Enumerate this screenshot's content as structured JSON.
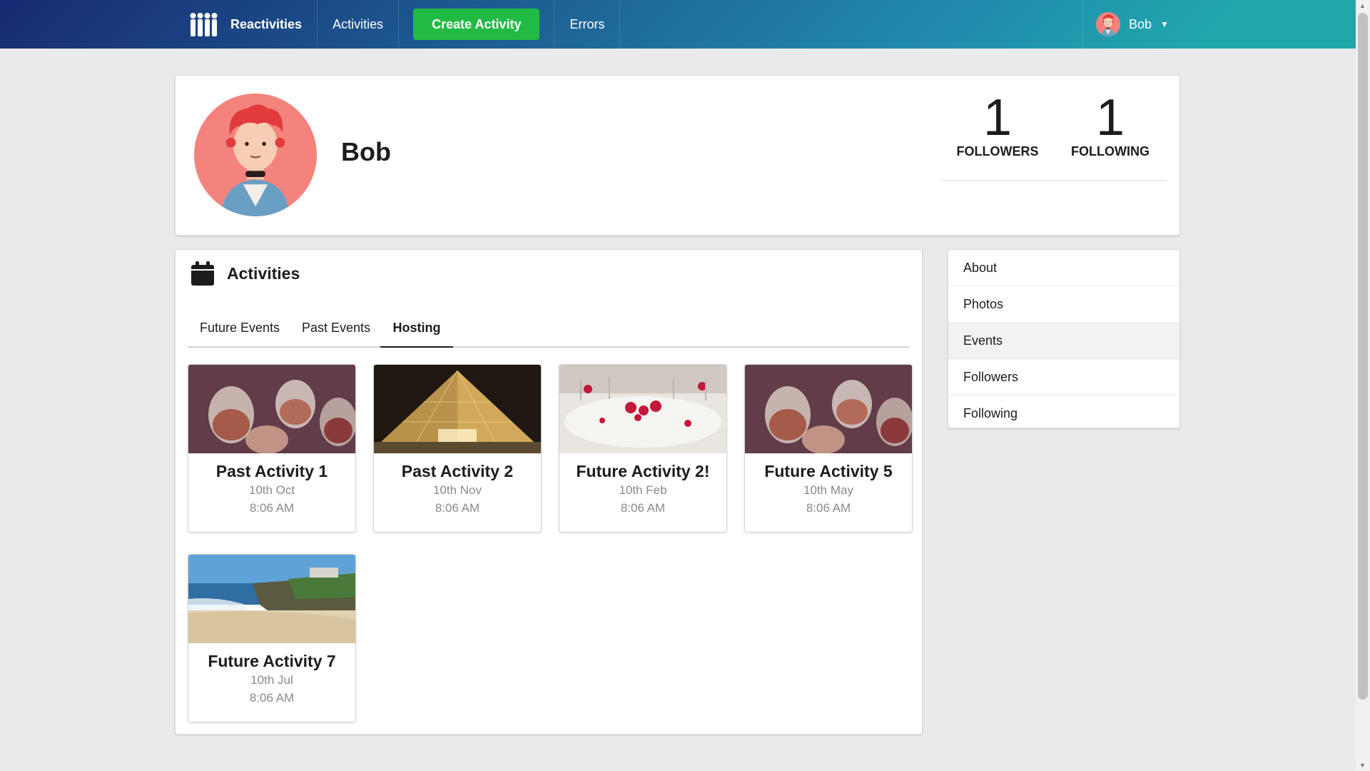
{
  "nav": {
    "brand": "Reactivities",
    "activities": "Activities",
    "create": "Create Activity",
    "errors": "Errors",
    "user": "Bob"
  },
  "profile": {
    "name": "Bob",
    "followers_count": "1",
    "followers_label": "FOLLOWERS",
    "following_count": "1",
    "following_label": "FOLLOWING"
  },
  "activities": {
    "title": "Activities",
    "tabs": [
      {
        "label": "Future Events",
        "active": false
      },
      {
        "label": "Past Events",
        "active": false
      },
      {
        "label": "Hosting",
        "active": true
      }
    ],
    "cards": [
      {
        "title": "Past Activity 1",
        "date": "10th Oct",
        "time": "8:06 AM",
        "image": "drinks"
      },
      {
        "title": "Past Activity 2",
        "date": "10th Nov",
        "time": "8:06 AM",
        "image": "culture"
      },
      {
        "title": "Future Activity 2!",
        "date": "10th Feb",
        "time": "8:06 AM",
        "image": "food"
      },
      {
        "title": "Future Activity 5",
        "date": "10th May",
        "time": "8:06 AM",
        "image": "drinks"
      },
      {
        "title": "Future Activity 7",
        "date": "10th Jul",
        "time": "8:06 AM",
        "image": "travel"
      }
    ]
  },
  "side_menu": [
    {
      "label": "About",
      "active": false
    },
    {
      "label": "Photos",
      "active": false
    },
    {
      "label": "Events",
      "active": true
    },
    {
      "label": "Followers",
      "active": false
    },
    {
      "label": "Following",
      "active": false
    }
  ],
  "colors": {
    "nav_start": "#182a73",
    "nav_end": "#20a7ac",
    "create_button": "#21ba45",
    "avatar_bg": "#f4837d"
  }
}
